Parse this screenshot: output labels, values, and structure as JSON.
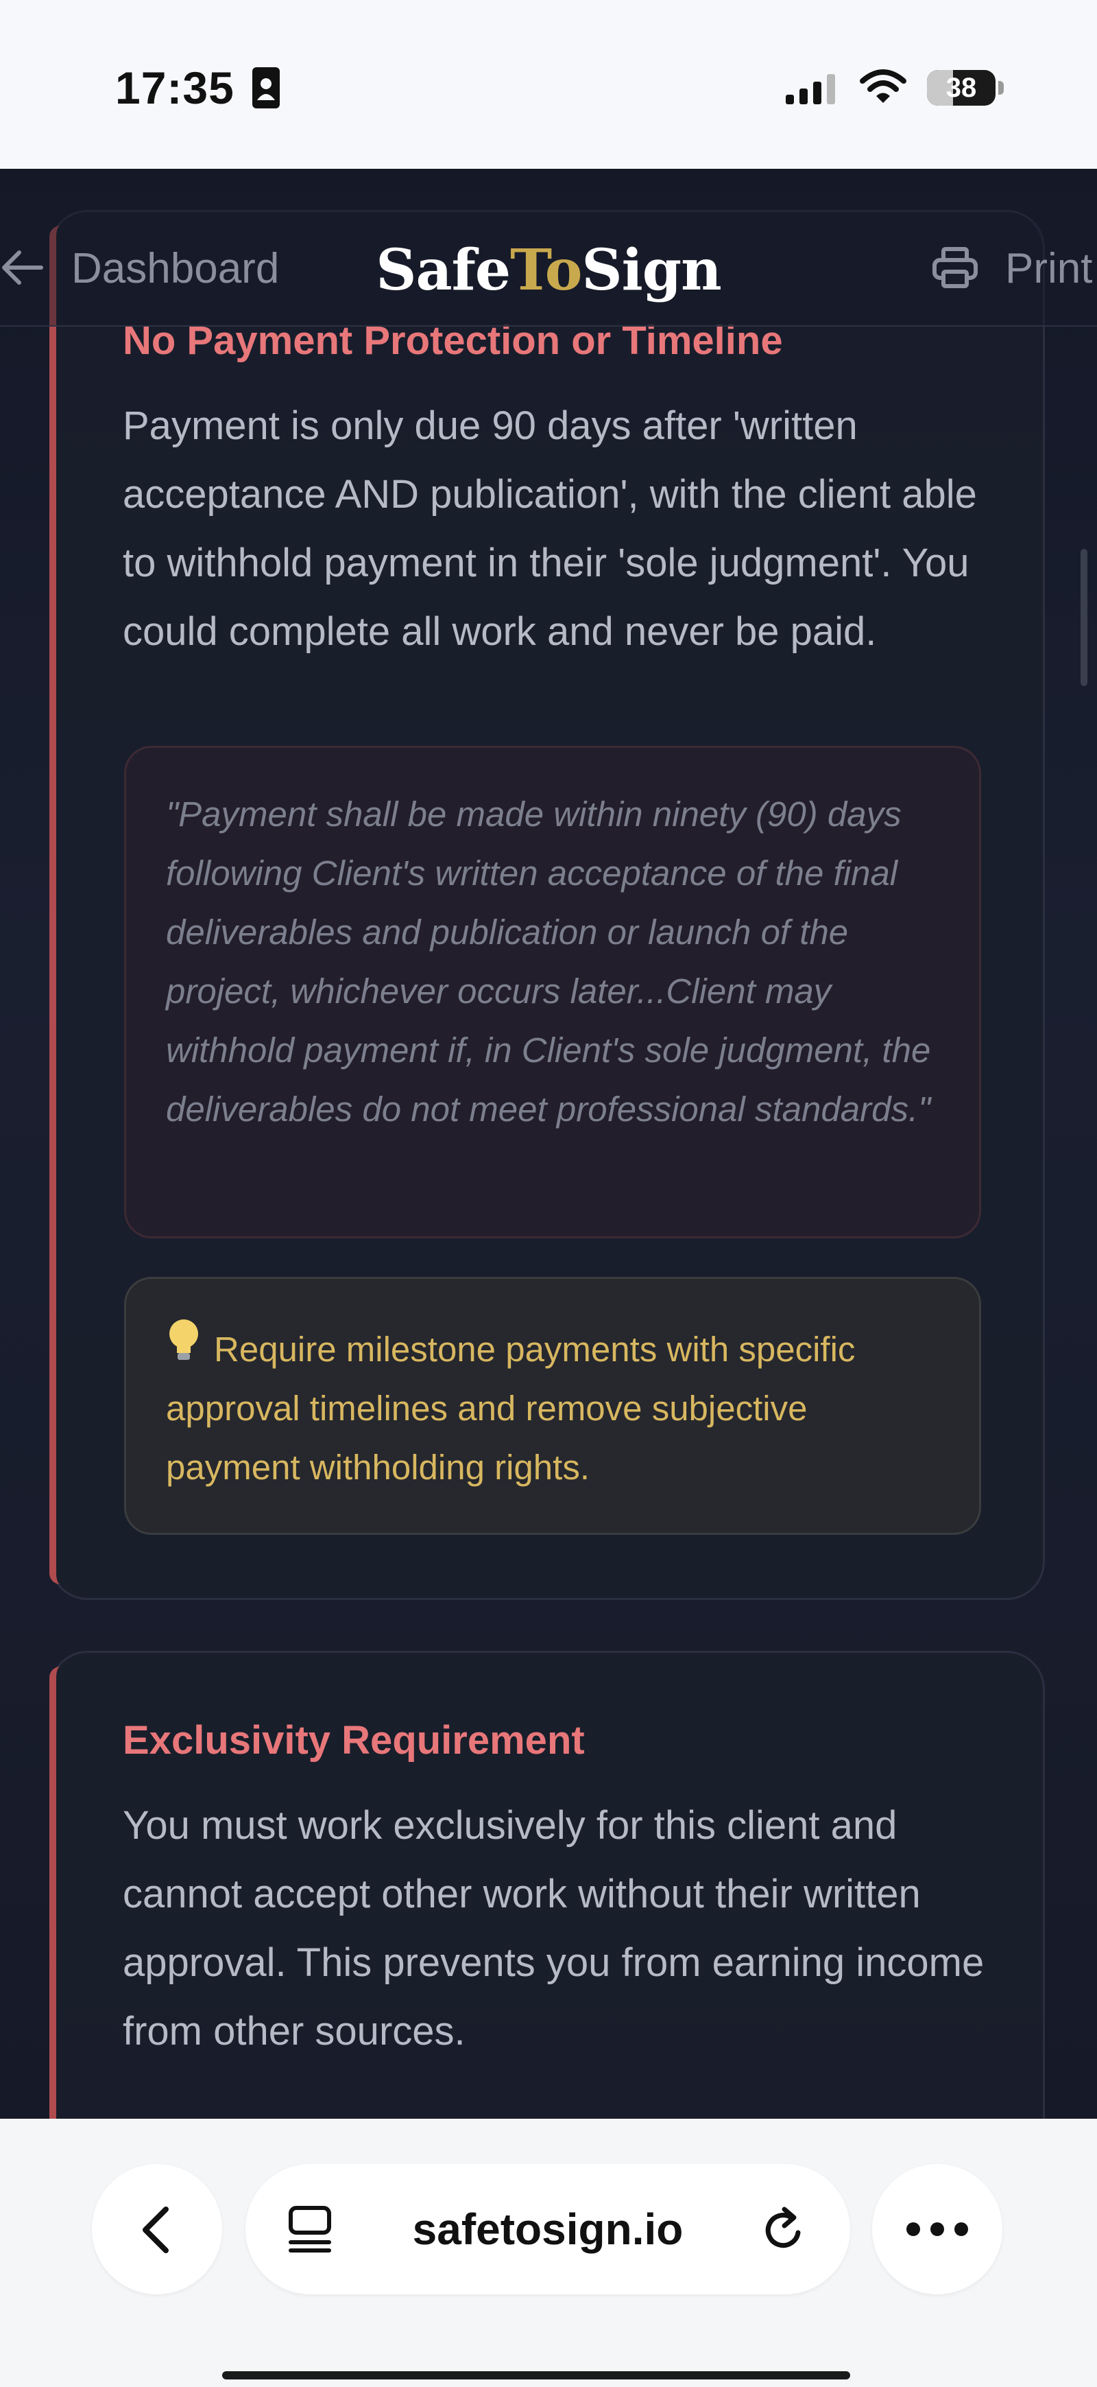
{
  "status_bar": {
    "time": "17:35",
    "battery_level": "38",
    "battery_fraction": 0.38
  },
  "header": {
    "back_label": "Dashboard",
    "logo_part1": "Safe",
    "logo_part2": "To",
    "logo_part3": "Sign",
    "print_label": "Print"
  },
  "issues": [
    {
      "title": "No Payment Protection or Timeline",
      "description": "Payment is only due 90 days after 'written acceptance AND publication', with the client able to withhold payment in their 'sole judgment'. You could complete all work and never be paid.",
      "quote": "\"Payment shall be made within ninety (90) days following Client's written acceptance of the final deliverables and publication or launch of the project, whichever occurs later...Client may withhold payment if, in Client's sole judgment, the deliverables do not meet professional standards.\"",
      "tip": "Require milestone payments with specific approval timelines and remove subjective payment withholding rights."
    },
    {
      "title": "Exclusivity Requirement",
      "description": "You must work exclusively for this client and cannot accept other work without their written approval. This prevents you from earning income from other sources."
    }
  ],
  "browser": {
    "url": "safetosign.io"
  },
  "colors": {
    "accent_red": "#e8777a",
    "tip_gold": "#d8b760",
    "logo_gold": "#c9a94e",
    "page_bg": "#181c2b"
  }
}
